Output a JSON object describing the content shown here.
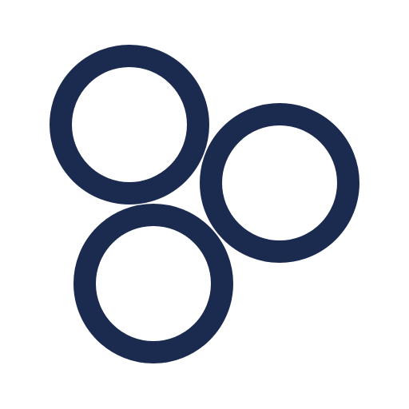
{
  "icon": {
    "name": "three-rings-icon",
    "ring_color": "#1b2b4f",
    "background": "#ffffff",
    "ring_count": 3
  }
}
